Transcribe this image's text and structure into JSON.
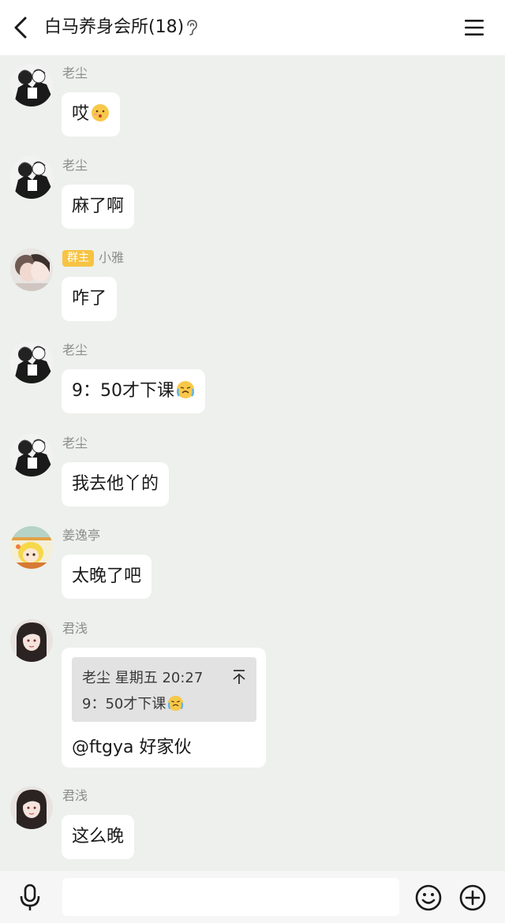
{
  "header": {
    "title": "白马养身会所(18)",
    "ear_icon": "ear-icon",
    "back_icon": "chevron-left-icon",
    "menu_icon": "hamburger-menu-icon"
  },
  "messages": [
    {
      "nick": "老尘",
      "text": "哎",
      "emoji": "pouting-face-emoji",
      "avatar": "manga-couple"
    },
    {
      "nick": "老尘",
      "text": "麻了啊",
      "avatar": "manga-couple"
    },
    {
      "nick": "小雅",
      "badge": "群主",
      "text": "咋了",
      "avatar": "couple-photo"
    },
    {
      "nick": "老尘",
      "text": "9：50才下课",
      "emoji": "crying-face-emoji",
      "avatar": "manga-couple"
    },
    {
      "nick": "老尘",
      "text": "我去他丫的",
      "avatar": "manga-couple"
    },
    {
      "nick": "姜逸亭",
      "text": "太晚了吧",
      "avatar": "anime-blonde-girl"
    },
    {
      "nick": "君浅",
      "avatar": "anime-dark-hair",
      "reply": {
        "quote_meta": "老尘 星期五 20:27",
        "quote_text": "9：50才下课",
        "quote_emoji": "crying-face-emoji",
        "text": "@ftgya 好家伙"
      }
    },
    {
      "nick": "君浅",
      "text": "这么晚",
      "avatar": "anime-dark-hair"
    }
  ],
  "input": {
    "placeholder": "",
    "value": ""
  },
  "bottom": {
    "mic_icon": "microphone-icon",
    "emoji_icon": "smiley-icon",
    "plus_icon": "plus-circle-icon"
  },
  "colors": {
    "background": "#edf0ec",
    "bubble": "#ffffff",
    "badge": "#f6c343",
    "quote_bg": "#e2e2e2"
  }
}
